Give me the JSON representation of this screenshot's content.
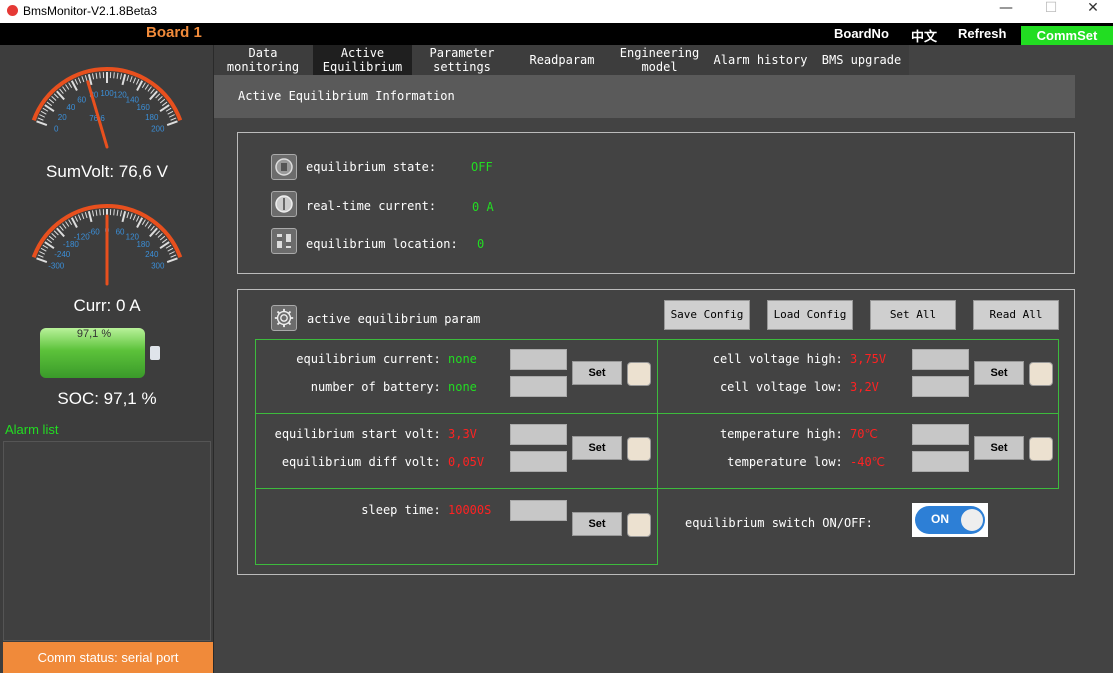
{
  "window": {
    "title": "BmsMonitor-V2.1.8Beta3",
    "minimize": "—",
    "maximize": "☐",
    "close": "✕"
  },
  "topbar": {
    "board": "Board 1",
    "board_no": "BoardNo",
    "language": "中文",
    "refresh": "Refresh",
    "commset": "CommSet"
  },
  "sidebar": {
    "volt_gauge": {
      "ticks": [
        "0",
        "20",
        "40",
        "60",
        "80",
        "100",
        "120",
        "140",
        "160",
        "180",
        "200"
      ],
      "value_text": "76,6",
      "value": 76.6,
      "min": 0,
      "max": 200
    },
    "sum_volt": "SumVolt: 76,6 V",
    "curr_gauge": {
      "ticks": [
        "-300",
        "-240",
        "-180",
        "-120",
        "-60",
        "0",
        "60",
        "120",
        "180",
        "240",
        "300"
      ],
      "value": 0,
      "min": -300,
      "max": 300
    },
    "curr": "Curr: 0 A",
    "battery_percent": "97,1 %",
    "battery_level": 0.971,
    "soc": "SOC: 97,1 %",
    "alarm_list": "Alarm list",
    "comm_status": "Comm status: serial port"
  },
  "tabs": [
    {
      "line1": "Data",
      "line2": "monitoring"
    },
    {
      "line1": "Active",
      "line2": "Equilibrium"
    },
    {
      "line1": "Parameter",
      "line2": "settings"
    },
    {
      "line1": "Readparam",
      "line2": ""
    },
    {
      "line1": "Engineering",
      "line2": "model"
    },
    {
      "line1": "Alarm history",
      "line2": ""
    },
    {
      "line1": "BMS upgrade",
      "line2": ""
    }
  ],
  "section_title": "Active Equilibrium Information",
  "info": {
    "state_label": "equilibrium state:",
    "state_value": "OFF",
    "current_label": "real-time current:",
    "current_value": "0 A",
    "location_label": "equilibrium location:",
    "location_value": "0"
  },
  "params": {
    "title": "active equilibrium param",
    "save_config": "Save Config",
    "load_config": "Load Config",
    "set_all": "Set All",
    "read_all": "Read All",
    "set": "Set",
    "eq_current_label": "equilibrium current:",
    "eq_current_value": "none",
    "num_battery_label": "number of battery:",
    "num_battery_value": "none",
    "cell_high_label": "cell voltage high:",
    "cell_high_value": "3,75V",
    "cell_low_label": "cell voltage low:",
    "cell_low_value": "3,2V",
    "start_volt_label": "equilibrium start volt:",
    "start_volt_value": "3,3V",
    "diff_volt_label": "equilibrium diff volt:",
    "diff_volt_value": "0,05V",
    "temp_high_label": "temperature high:",
    "temp_high_value": "70℃",
    "temp_low_label": "temperature low:",
    "temp_low_value": "-40℃",
    "sleep_label": "sleep time:",
    "sleep_value": "10000S",
    "switch_label": "equilibrium switch ON/OFF:",
    "switch_state": "ON"
  },
  "colors": {
    "accent_orange": "#f08a3a",
    "green": "#22dd22",
    "red": "#ff2222",
    "gauge_arc": "#e8501e",
    "gauge_tick_text": "#3b8fd8"
  }
}
